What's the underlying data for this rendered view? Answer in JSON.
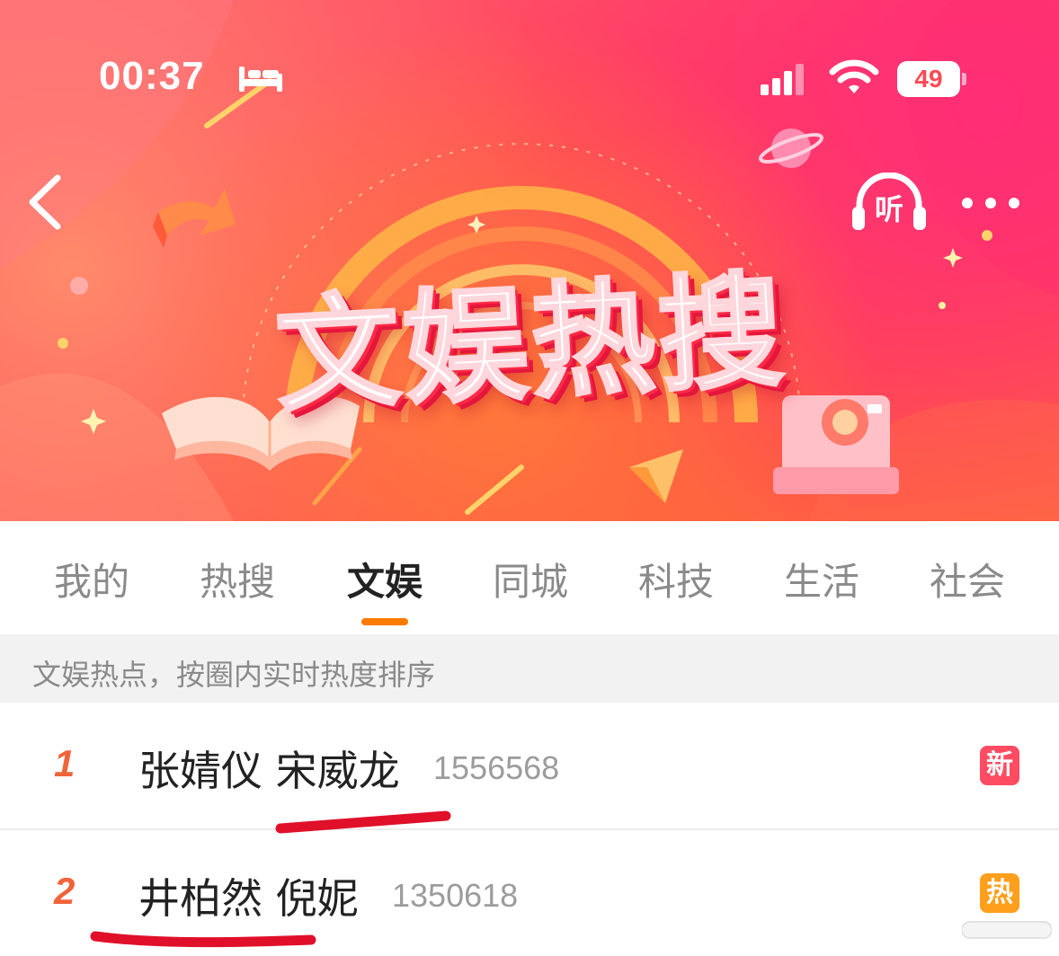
{
  "status_bar": {
    "time": "00:37",
    "battery_level": "49",
    "icons": [
      "bed-icon",
      "signal-icon",
      "wifi-icon",
      "battery-icon"
    ]
  },
  "nav": {
    "back_icon": "chevron-left-icon",
    "listen_label": "听",
    "more_icon": "more-dots-icon"
  },
  "banner": {
    "title": "文娱热搜"
  },
  "tabs": [
    {
      "label": "我的"
    },
    {
      "label": "热搜"
    },
    {
      "label": "文娱",
      "active": true
    },
    {
      "label": "同城"
    },
    {
      "label": "科技"
    },
    {
      "label": "生活"
    },
    {
      "label": "社会"
    }
  ],
  "hint": "文娱热点，按圈内实时热度排序",
  "list": [
    {
      "rank": "1",
      "topic": "张婧仪 宋威龙",
      "count": "1556568",
      "badge": "新",
      "badge_color": "#ff4c62"
    },
    {
      "rank": "2",
      "topic": "井柏然 倪妮",
      "count": "1350618",
      "badge": "热",
      "badge_color": "#ff9f1c"
    }
  ],
  "colors": {
    "accent": "#ff7a00",
    "rank": "#f0643a",
    "underline_annotation": "#e0102a"
  }
}
